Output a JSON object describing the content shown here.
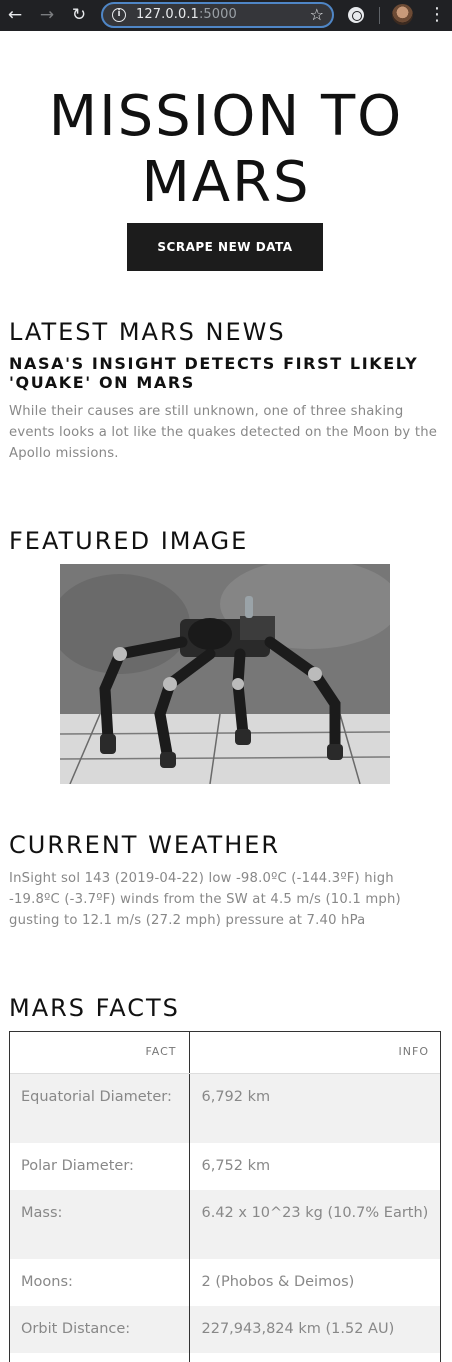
{
  "browser": {
    "url_host": "127.0.0.1",
    "url_port": ":5000",
    "info_glyph": "i",
    "back_glyph": "←",
    "forward_glyph": "→",
    "reload_glyph": "↻",
    "star_glyph": "☆",
    "menu_glyph": "⋮"
  },
  "page": {
    "title": "MISSION TO MARS",
    "scrape_button": "SCRAPE NEW DATA"
  },
  "news": {
    "heading": "LATEST MARS NEWS",
    "title": "NASA'S INSIGHT DETECTS FIRST LIKELY 'QUAKE' ON MARS",
    "paragraph": "While their causes are still unknown, one of three shaking events looks a lot like the quakes detected on the Moon by the Apollo missions."
  },
  "featured": {
    "heading": "FEATURED IMAGE",
    "image_icon": "robot-rover-photo"
  },
  "weather": {
    "heading": "CURRENT WEATHER",
    "text": "InSight sol 143 (2019-04-22) low -98.0ºC (-144.3ºF) high -19.8ºC (-3.7ºF) winds from the SW at 4.5 m/s (10.1 mph) gusting to 12.1 m/s (27.2 mph) pressure at 7.40 hPa"
  },
  "facts": {
    "heading": "MARS FACTS",
    "columns": [
      "FACT",
      "INFO"
    ],
    "rows": [
      {
        "fact": "Equatorial Diameter:",
        "info": "6,792 km"
      },
      {
        "fact": "Polar Diameter:",
        "info": "6,752 km"
      },
      {
        "fact": "Mass:",
        "info": "6.42 x 10^23 kg (10.7% Earth)"
      },
      {
        "fact": "Moons:",
        "info": "2 (Phobos & Deimos)"
      },
      {
        "fact": "Orbit Distance:",
        "info": "227,943,824 km (1.52 AU)"
      },
      {
        "fact": "",
        "info": ""
      }
    ]
  },
  "colors": {
    "button_bg": "#1c1c1c",
    "muted_text": "#888888",
    "row_alt": "#f1f1f1"
  }
}
